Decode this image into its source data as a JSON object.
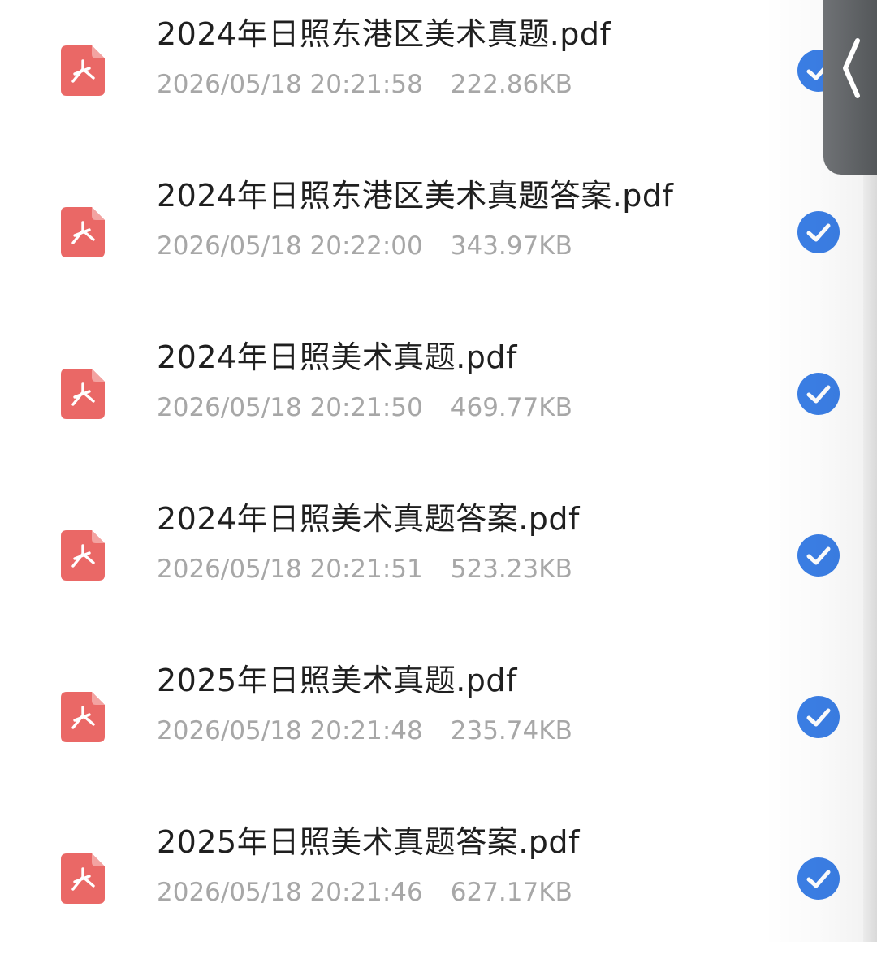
{
  "files": [
    {
      "name": "2024年日照东港区美术真题.pdf",
      "datetime": "2026/05/18 20:21:58",
      "size": "222.86KB",
      "selected": true,
      "icon": "pdf-icon"
    },
    {
      "name": "2024年日照东港区美术真题答案.pdf",
      "datetime": "2026/05/18 20:22:00",
      "size": "343.97KB",
      "selected": true,
      "icon": "pdf-icon"
    },
    {
      "name": "2024年日照美术真题.pdf",
      "datetime": "2026/05/18 20:21:50",
      "size": "469.77KB",
      "selected": true,
      "icon": "pdf-icon"
    },
    {
      "name": "2024年日照美术真题答案.pdf",
      "datetime": "2026/05/18 20:21:51",
      "size": "523.23KB",
      "selected": true,
      "icon": "pdf-icon"
    },
    {
      "name": "2025年日照美术真题.pdf",
      "datetime": "2026/05/18 20:21:48",
      "size": "235.74KB",
      "selected": true,
      "icon": "pdf-icon"
    },
    {
      "name": "2025年日照美术真题答案.pdf",
      "datetime": "2026/05/18 20:21:46",
      "size": "627.17KB",
      "selected": true,
      "icon": "pdf-icon"
    }
  ],
  "side_handle": {
    "icon": "chevron-left-icon"
  },
  "colors": {
    "pdf_icon": "#ea6866",
    "check_accent": "#3b7fe6",
    "name_text": "#1f1f1f",
    "meta_text": "#a7a7a7",
    "handle_bg": "#5f6265"
  }
}
